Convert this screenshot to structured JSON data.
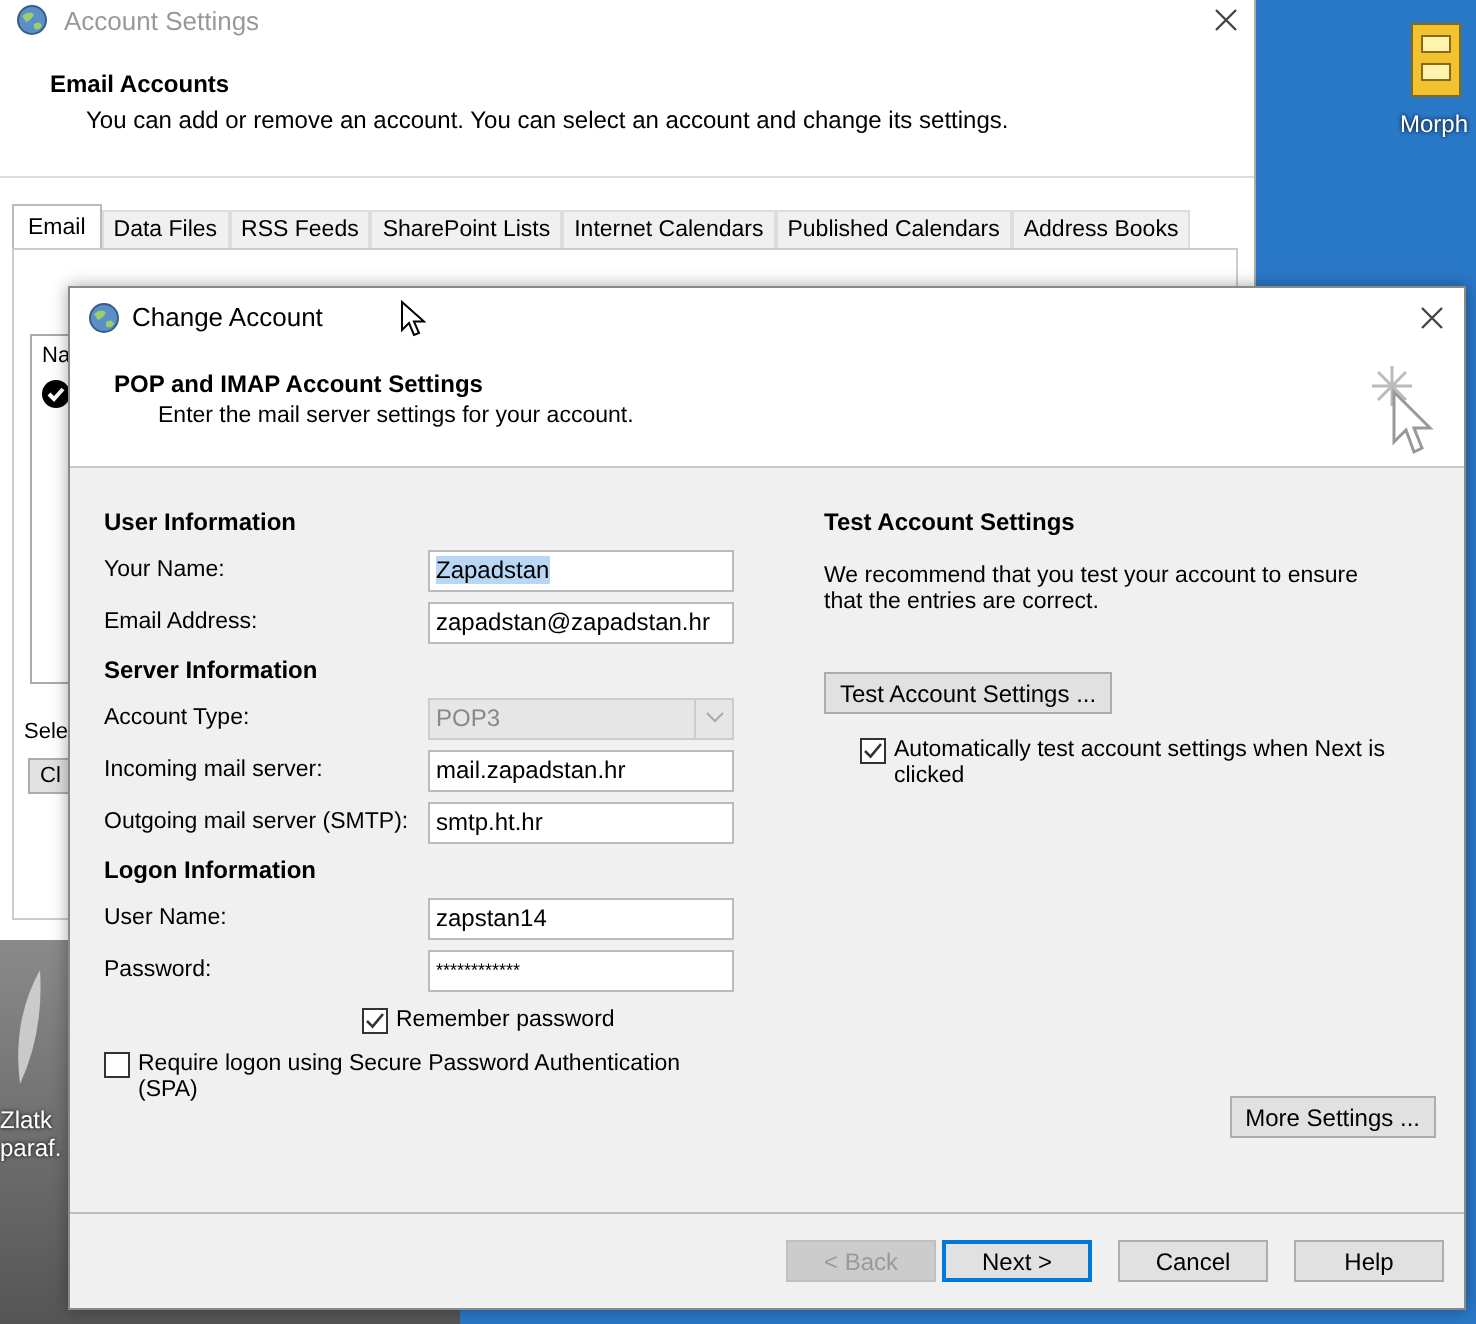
{
  "desktop_icons": [
    {
      "lines": [
        "Morph"
      ]
    },
    {
      "lines": [
        "Zlatk",
        "paraf."
      ]
    }
  ],
  "background_window": {
    "title": "Account Settings",
    "heading": "Email Accounts",
    "description": "You can add or remove an account. You can select an account and change its settings.",
    "tabs": [
      {
        "label": "Email",
        "selected": true
      },
      {
        "label": "Data Files",
        "selected": false
      },
      {
        "label": "RSS Feeds",
        "selected": false
      },
      {
        "label": "SharePoint Lists",
        "selected": false
      },
      {
        "label": "Internet Calendars",
        "selected": false
      },
      {
        "label": "Published Calendars",
        "selected": false
      },
      {
        "label": "Address Books",
        "selected": false
      }
    ],
    "list_header": "Na",
    "select_label": "Sele",
    "button": "Cl"
  },
  "dialog": {
    "title": "Change Account",
    "heading": "POP and IMAP Account Settings",
    "subheading": "Enter the mail server settings for your account.",
    "sections": [
      {
        "title": "User Information",
        "fields": [
          {
            "label": "Your Name:",
            "value": "Zapadstan",
            "kind": "text",
            "highlighted": true
          },
          {
            "label": "Email Address:",
            "value": "zapadstan@zapadstan.hr",
            "kind": "text",
            "highlighted": false
          }
        ]
      },
      {
        "title": "Server Information",
        "fields": [
          {
            "label": "Account Type:",
            "value": "POP3",
            "kind": "dropdown",
            "highlighted": false
          },
          {
            "label": "Incoming mail server:",
            "value": "mail.zapadstan.hr",
            "kind": "text",
            "highlighted": false
          },
          {
            "label": "Outgoing mail server (SMTP):",
            "value": "smtp.ht.hr",
            "kind": "text",
            "highlighted": false
          }
        ]
      },
      {
        "title": "Logon Information",
        "fields": [
          {
            "label": "User Name:",
            "value": "zapstan14",
            "kind": "text",
            "highlighted": false
          },
          {
            "label": "Password:",
            "value": "************",
            "kind": "password",
            "highlighted": false
          }
        ]
      }
    ],
    "remember_password": {
      "label": "Remember password",
      "checked": true
    },
    "spa": {
      "label": "Require logon using Secure Password Authentication (SPA)",
      "checked": false
    },
    "test": {
      "title": "Test Account Settings",
      "description": "We recommend that you test your account to ensure that the entries are correct.",
      "button": "Test Account Settings ...",
      "auto_test": {
        "label": "Automatically test account settings when Next is clicked",
        "checked": true
      }
    },
    "more_settings": "More Settings ...",
    "buttons": [
      {
        "label": "< Back",
        "disabled": true,
        "default": false
      },
      {
        "label": "Next >",
        "disabled": false,
        "default": true
      },
      {
        "label": "Cancel",
        "disabled": false,
        "default": false
      },
      {
        "label": "Help",
        "disabled": false,
        "default": false
      }
    ]
  }
}
